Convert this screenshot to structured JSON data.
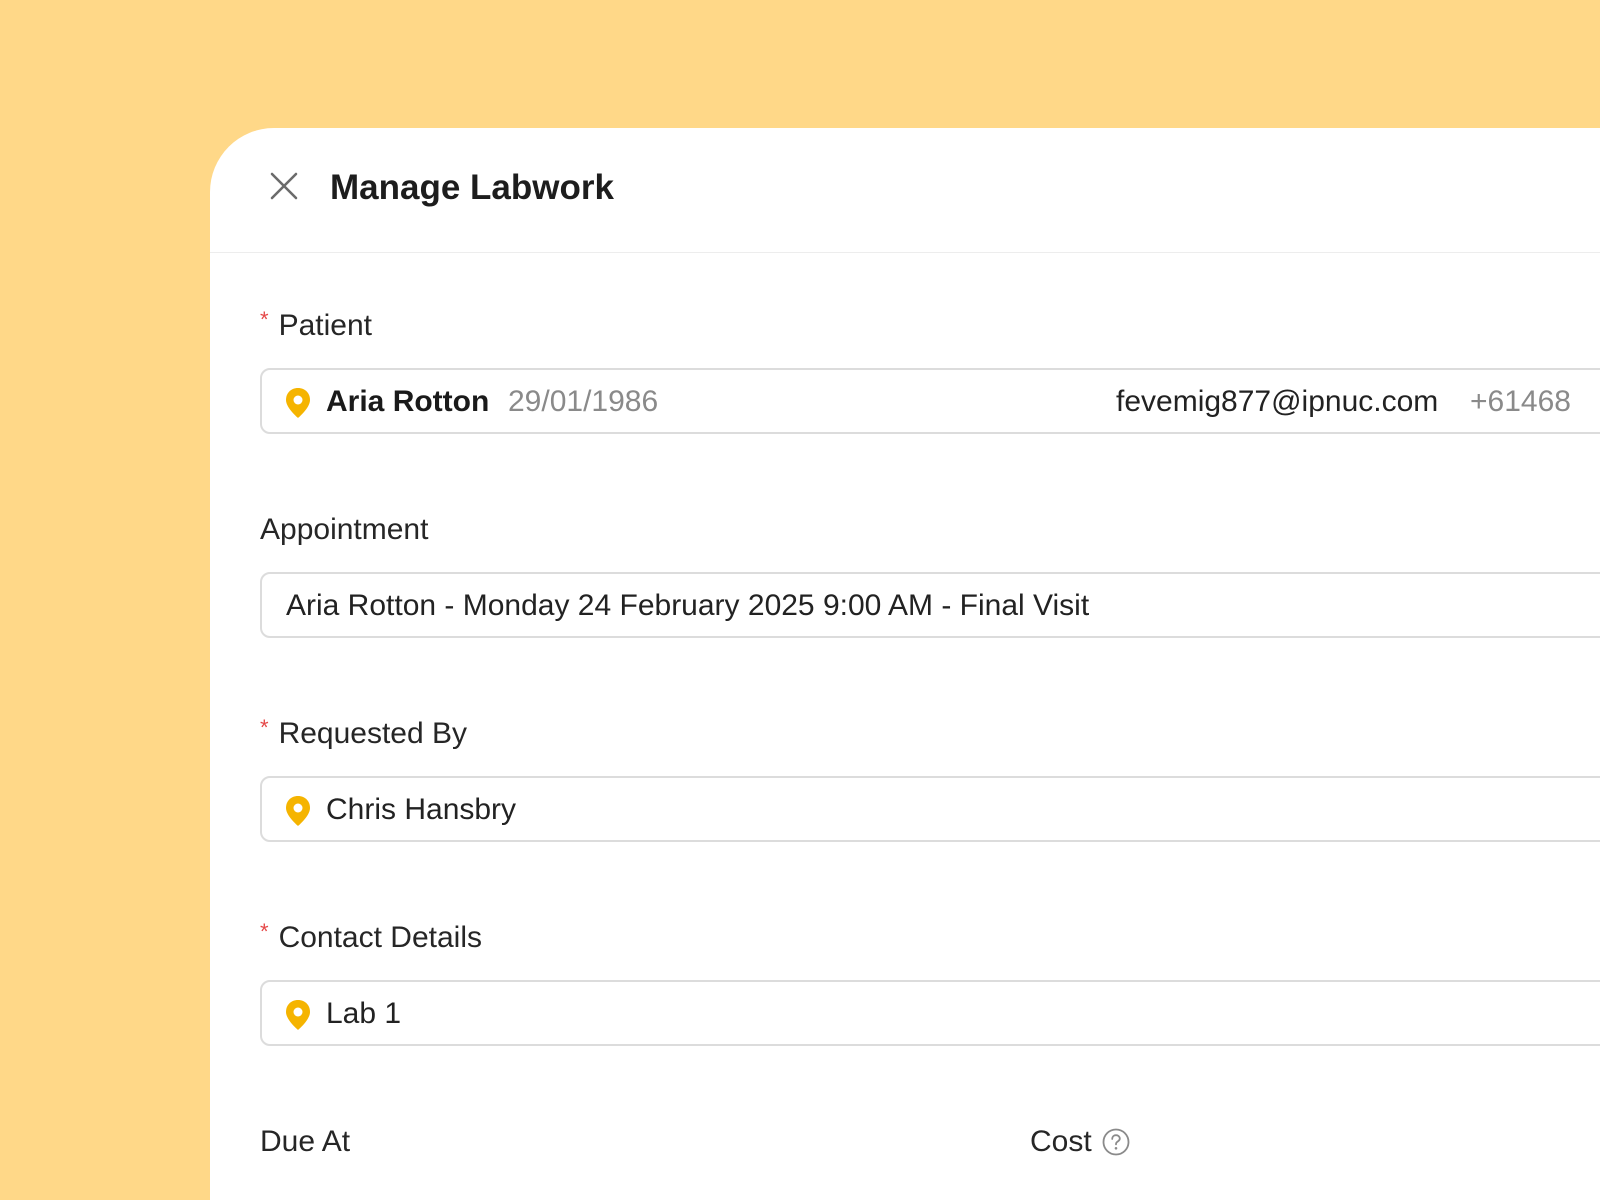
{
  "header": {
    "title": "Manage Labwork"
  },
  "fields": {
    "patient": {
      "label": "Patient",
      "required_mark": "*",
      "name": "Aria Rotton",
      "dob": "29/01/1986",
      "email": "fevemig877@ipnuc.com",
      "phone": "+61468",
      "icon": "location-pin-icon"
    },
    "appointment": {
      "label": "Appointment",
      "value": "Aria Rotton - Monday 24 February 2025 9:00 AM - Final Visit"
    },
    "requested_by": {
      "label": "Requested By",
      "required_mark": "*",
      "value": "Chris Hansbry",
      "icon": "location-pin-icon"
    },
    "contact_details": {
      "label": "Contact Details",
      "required_mark": "*",
      "value": "Lab 1",
      "icon": "location-pin-icon"
    },
    "due_at": {
      "label": "Due At"
    },
    "cost": {
      "label": "Cost",
      "icon": "help-circle-icon"
    }
  },
  "colors": {
    "background": "#FFD888",
    "accent_pin": "#F5B400",
    "required": "#E54848"
  }
}
